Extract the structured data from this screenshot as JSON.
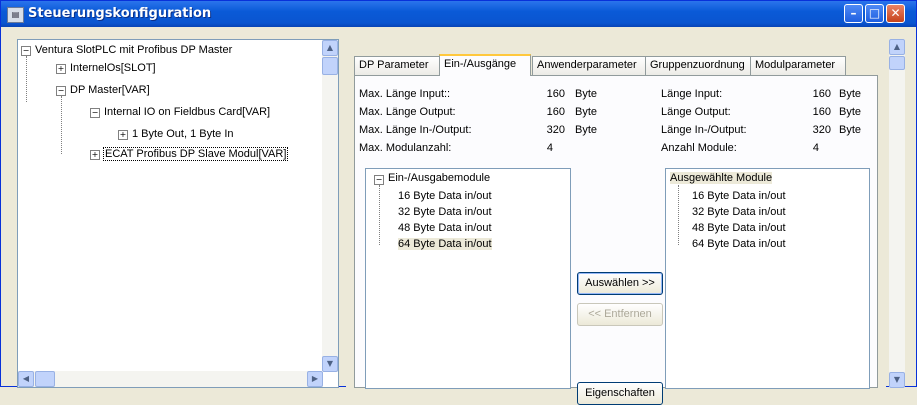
{
  "window": {
    "title": "Steuerungskonfiguration",
    "icon": "app-icon",
    "controls": {
      "minimize": "–",
      "maximize": "□",
      "close": "✕"
    }
  },
  "tree": {
    "root": "Ventura SlotPLC mit Profibus DP Master",
    "items": [
      {
        "label": "InternelOs[SLOT]",
        "expander": "+"
      },
      {
        "label": "DP Master[VAR]",
        "expander": "−"
      },
      {
        "label": "Internal IO on Fieldbus Card[VAR]",
        "expander": "−"
      },
      {
        "label": "1 Byte Out, 1 Byte In",
        "expander": "+"
      },
      {
        "label": "ECAT Profibus DP Slave Modul[VAR]",
        "expander": "+"
      }
    ],
    "root_expander": "−"
  },
  "tabs": [
    {
      "label": "DP Parameter"
    },
    {
      "label": "Ein-/Ausgänge"
    },
    {
      "label": "Anwenderparameter"
    },
    {
      "label": "Gruppenzuordnung"
    },
    {
      "label": "Modulparameter"
    }
  ],
  "limits": [
    {
      "label": "Max. Länge Input::",
      "value": "160",
      "unit": "Byte"
    },
    {
      "label": "Max. Länge Output:",
      "value": "160",
      "unit": "Byte"
    },
    {
      "label": "Max. Länge In-/Output:",
      "value": "320",
      "unit": "Byte"
    },
    {
      "label": "Max. Modulanzahl:",
      "value": "4",
      "unit": ""
    }
  ],
  "current": [
    {
      "label": "Länge Input:",
      "value": "160",
      "unit": "Byte"
    },
    {
      "label": "Länge Output:",
      "value": "160",
      "unit": "Byte"
    },
    {
      "label": "Länge In-/Output:",
      "value": "320",
      "unit": "Byte"
    },
    {
      "label": "Anzahl Module:",
      "value": "4",
      "unit": ""
    }
  ],
  "available": {
    "group": "Ein-/Ausgabemodule",
    "group_expander": "−",
    "items": [
      "16 Byte Data in/out",
      "32 Byte Data in/out",
      "48 Byte Data in/out",
      "64 Byte Data in/out"
    ]
  },
  "selected": {
    "header": "Ausgewählte Module",
    "items": [
      "16 Byte Data in/out",
      "32 Byte Data in/out",
      "48 Byte Data in/out",
      "64 Byte Data in/out"
    ]
  },
  "buttons": {
    "select": "Auswählen >>",
    "remove": "<< Entfernen",
    "properties": "Eigenschaften"
  },
  "scroll": {
    "up": "▲",
    "down": "▼",
    "left": "◀",
    "right": "▶"
  }
}
